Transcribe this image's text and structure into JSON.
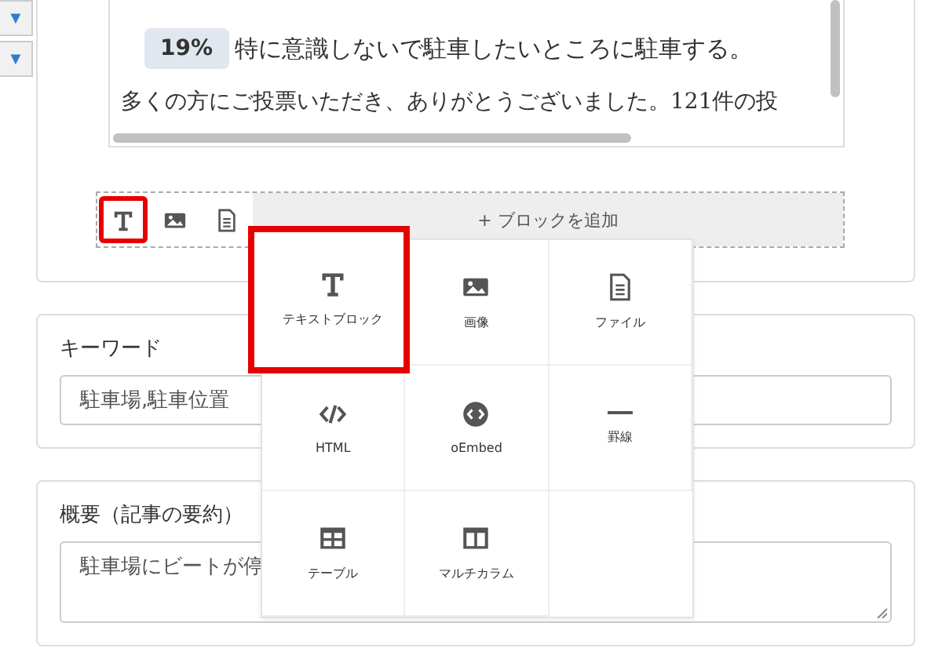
{
  "side_buttons": [
    {
      "label": "▼"
    },
    {
      "label": "▼"
    }
  ],
  "preview": {
    "poll_rows": [
      {
        "percent": "19%",
        "text": "特に意識しないで駐車したいところに駐車する。"
      }
    ],
    "paragraph": "多くの方にご投票いただき、ありがとうございました。121件の投"
  },
  "toolbar": {
    "items": [
      {
        "kind": "text",
        "selected": true
      },
      {
        "kind": "image",
        "selected": false
      },
      {
        "kind": "file",
        "selected": false
      }
    ],
    "add_button": "+ ブロックを追加"
  },
  "block_menu": {
    "items": [
      {
        "kind": "text",
        "label": "テキストブロック",
        "selected": true
      },
      {
        "kind": "image",
        "label": "画像",
        "selected": false
      },
      {
        "kind": "file",
        "label": "ファイル",
        "selected": false
      },
      {
        "kind": "html",
        "label": "HTML",
        "selected": false
      },
      {
        "kind": "oembed",
        "label": "oEmbed",
        "selected": false
      },
      {
        "kind": "rule",
        "label": "罫線",
        "selected": false
      },
      {
        "kind": "table",
        "label": "テーブル",
        "selected": false
      },
      {
        "kind": "columns",
        "label": "マルチカラム",
        "selected": false
      }
    ]
  },
  "keyword": {
    "label": "キーワード",
    "value": "駐車場,駐車位置"
  },
  "summary": {
    "label": "概要（記事の要約）",
    "value": "駐車場にビートが停"
  }
}
